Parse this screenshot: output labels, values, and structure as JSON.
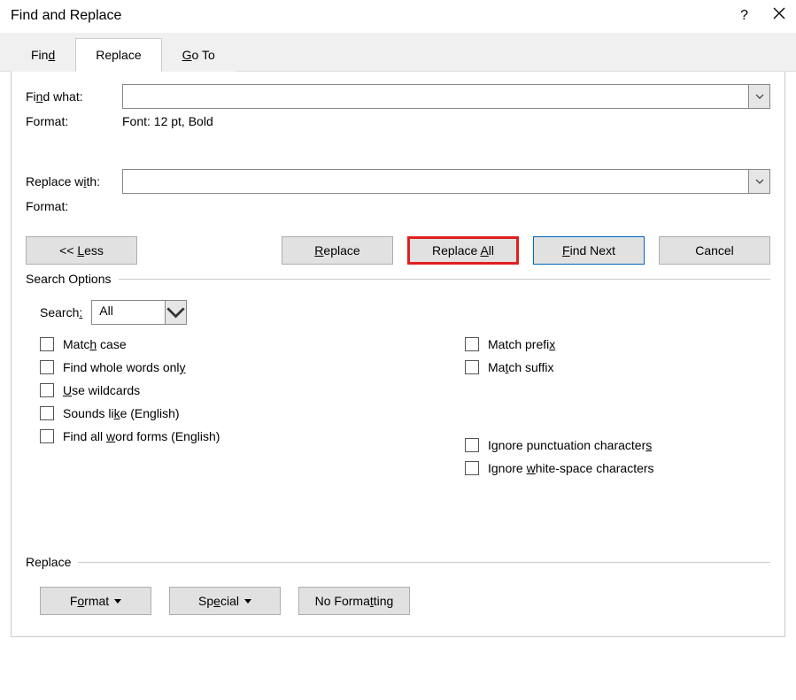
{
  "title": "Find and Replace",
  "tabs": {
    "find": "Find",
    "replace": "Replace",
    "goto": "Go To"
  },
  "fields": {
    "find_what_label": "Find what:",
    "find_what_value": "",
    "format_label": "Format:",
    "find_format_value": "Font: 12 pt, Bold",
    "replace_with_label": "Replace with:",
    "replace_with_value": "",
    "replace_format_value": ""
  },
  "buttons": {
    "less": "<< Less",
    "replace": "Replace",
    "replace_all": "Replace All",
    "find_next": "Find Next",
    "cancel": "Cancel",
    "format": "Format",
    "special": "Special",
    "no_formatting": "No Formatting"
  },
  "options": {
    "legend": "Search Options",
    "search_label": "Search:",
    "search_value": "All",
    "match_case": "Match case",
    "whole_words": "Find whole words only",
    "use_wildcards": "Use wildcards",
    "sounds_like": "Sounds like (English)",
    "word_forms": "Find all word forms (English)",
    "match_prefix": "Match prefix",
    "match_suffix": "Match suffix",
    "ignore_punct": "Ignore punctuation characters",
    "ignore_ws": "Ignore white-space characters"
  },
  "replace_section": {
    "legend": "Replace"
  }
}
